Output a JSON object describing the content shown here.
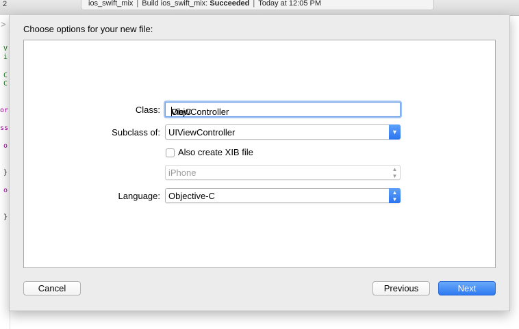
{
  "toolbar": {
    "tab_number": "2",
    "activity": {
      "project": "ios_swift_mix",
      "build_prefix": "Build ios_swift_mix:",
      "build_status": "Succeeded",
      "time": "Today at 12:05 PM"
    }
  },
  "editor": {
    "gutter_arrow": ">",
    "lines": [
      {
        "text": "V",
        "color": "green"
      },
      {
        "text": "i",
        "color": "green"
      },
      {
        "text": "C",
        "color": "green"
      },
      {
        "text": "C",
        "color": "green"
      },
      {
        "text": "or",
        "color": "purple"
      },
      {
        "text": "ss",
        "color": "purple"
      },
      {
        "text": "o",
        "color": "purple"
      },
      {
        "text": "}",
        "color": "black"
      },
      {
        "text": "o",
        "color": "purple"
      },
      {
        "text": "}",
        "color": "black"
      }
    ]
  },
  "dialog": {
    "title": "Choose options for your new file:",
    "class_label": "Class:",
    "class_value_before_caret": "ObjC",
    "class_value_after_caret": "ViewController",
    "subclass_label": "Subclass of:",
    "subclass_value": "UIViewController",
    "xib_label": "Also create XIB file",
    "xib_checked": false,
    "device_value": "iPhone",
    "language_label": "Language:",
    "language_value": "Objective-C",
    "buttons": {
      "cancel": "Cancel",
      "previous": "Previous",
      "next": "Next"
    }
  },
  "colors": {
    "accent": "#2d79f1",
    "code_green": "#1f7a1f",
    "code_purple": "#a4009f"
  }
}
